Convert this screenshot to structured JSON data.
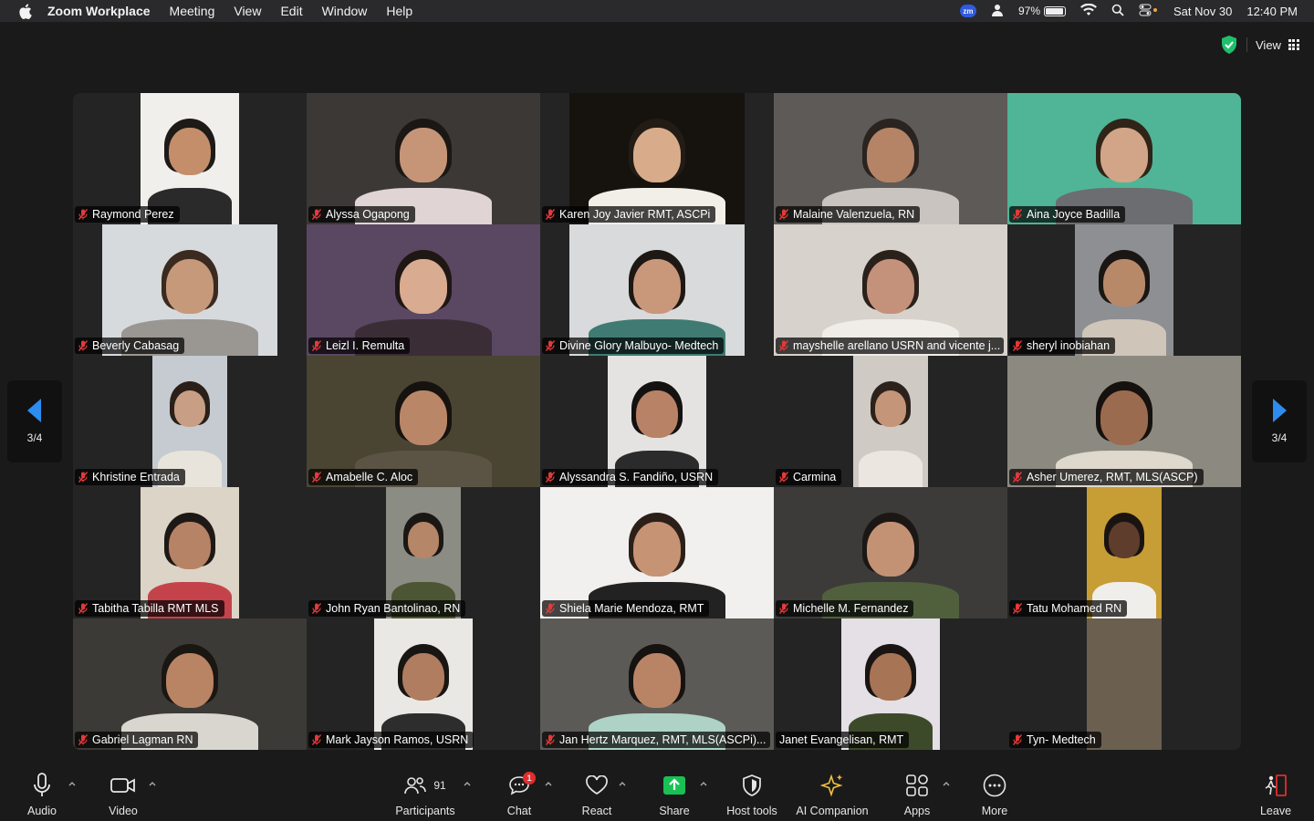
{
  "menubar": {
    "app_name": "Zoom Workplace",
    "items": [
      "Meeting",
      "View",
      "Edit",
      "Window",
      "Help"
    ],
    "battery": "97%",
    "date": "Sat Nov 30",
    "time": "12:40 PM",
    "zoom_badge": "zm"
  },
  "topbar": {
    "view_label": "View"
  },
  "pager": {
    "left_count": "3/4",
    "right_count": "3/4"
  },
  "participants": [
    {
      "name": "Raymond Perez",
      "bg": "#f0efec",
      "skin": "#c58e6b",
      "hair": "#1d1a18",
      "shirt": "#2a2a2a"
    },
    {
      "name": "Alyssa Ogapong",
      "bg": "#3b3836",
      "skin": "#c69578",
      "hair": "#1b1714",
      "shirt": "#e0d4d4"
    },
    {
      "name": "Karen Joy Javier RMT, ASCPi",
      "bg": "#16130f",
      "skin": "#d8ac8a",
      "hair": "#231c16",
      "shirt": "#f2efe9"
    },
    {
      "name": "Malaine Valenzuela, RN",
      "bg": "#5d5a57",
      "skin": "#b58466",
      "hair": "#2a2320",
      "shirt": "#c9c4c0"
    },
    {
      "name": "Aina Joyce Badilla",
      "bg": "#4fb596",
      "skin": "#d2a588",
      "hair": "#302418",
      "shirt": "#6c6d70"
    },
    {
      "name": "Beverly Cabasag",
      "bg": "#d7dadd",
      "skin": "#c6997b",
      "hair": "#3a2a1f",
      "shirt": "#9a9692"
    },
    {
      "name": "Leizl I. Remulta",
      "bg": "#5a4762",
      "skin": "#d9ab90",
      "hair": "#1f1714",
      "shirt": "#3b2d36"
    },
    {
      "name": "Divine Glory Malbuyo- Medtech",
      "bg": "#d9dadb",
      "skin": "#c9977a",
      "hair": "#1e1814",
      "shirt": "#3f7b73"
    },
    {
      "name": "mayshelle arellano USRN and vicente j...",
      "bg": "#d8d2cc",
      "skin": "#c4917a",
      "hair": "#2b211b",
      "shirt": "#f0ede8"
    },
    {
      "name": "sheryl inobiahan",
      "bg": "#8e8f93",
      "skin": "#b88969",
      "hair": "#1a1614",
      "shirt": "#cfc5b8"
    },
    {
      "name": "Khristine Entrada",
      "bg": "#c5cbd0",
      "skin": "#c89e84",
      "hair": "#2a2019",
      "shirt": "#e8e4dc"
    },
    {
      "name": "Amabelle C. Aloc",
      "bg": "#4a4433",
      "skin": "#b98768",
      "hair": "#161210",
      "shirt": "#5b5445"
    },
    {
      "name": "Alyssandra S. Fandiño, USRN",
      "bg": "#e4e3e1",
      "skin": "#b88266",
      "hair": "#141210",
      "shirt": "#2c2b2b"
    },
    {
      "name": "Carmina",
      "bg": "#cfcac4",
      "skin": "#c59579",
      "hair": "#2c221b",
      "shirt": "#ebe7e0"
    },
    {
      "name": "Asher Umerez, RMT, MLS(ASCP)",
      "bg": "#8c8a80",
      "skin": "#9b6b50",
      "hair": "#15110e",
      "shirt": "#ded8cd"
    },
    {
      "name": "Tabitha Tabilla RMT MLS",
      "bg": "#dcd4c6",
      "skin": "#b78366",
      "hair": "#1e1916",
      "shirt": "#c4434b"
    },
    {
      "name": "John Ryan Bantolinao, RN",
      "bg": "#8b8c84",
      "skin": "#b58667",
      "hair": "#1b1714",
      "shirt": "#4d5634"
    },
    {
      "name": "Shiela Marie Mendoza, RMT",
      "bg": "#f1f0ee",
      "skin": "#c69375",
      "hair": "#2b1f18",
      "shirt": "#222222"
    },
    {
      "name": "Michelle M. Fernandez",
      "bg": "#3c3b3a",
      "skin": "#c39275",
      "hair": "#1b1714",
      "shirt": "#50603d"
    },
    {
      "name": "Tatu Mohamed RN",
      "bg": "#c79d36",
      "skin": "#5f3d2c",
      "hair": "#1a1411",
      "shirt": "#f0eeea"
    },
    {
      "name": "Gabriel Lagman RN",
      "bg": "#3b3a37",
      "skin": "#b98464",
      "hair": "#1a1612",
      "shirt": "#d9d6cf"
    },
    {
      "name": "Mark Jayson Ramos, USRN",
      "bg": "#e9e8e5",
      "skin": "#b07d60",
      "hair": "#191513",
      "shirt": "#2d2d2d"
    },
    {
      "name": "Jan Hertz Marquez, RMT, MLS(ASCPi)...",
      "bg": "#5c5a57",
      "skin": "#b98466",
      "hair": "#151210",
      "shirt": "#aed3c6"
    },
    {
      "name": "Janet Evangelisan, RMT",
      "bg": "#e4e0e6",
      "skin": "#a87456",
      "hair": "#1a1512",
      "shirt": "#3d4a2a"
    },
    {
      "name": "Tyn- Medtech",
      "bg": "#6b5f50",
      "skin": "#6b5f50",
      "hair": "#6b5f50",
      "shirt": "#6b5f50"
    }
  ],
  "toolbar": {
    "audio": "Audio",
    "video": "Video",
    "participants": "Participants",
    "participants_count": "91",
    "chat": "Chat",
    "chat_badge": "1",
    "react": "React",
    "share": "Share",
    "host_tools": "Host tools",
    "ai_companion": "AI Companion",
    "apps": "Apps",
    "more": "More",
    "leave": "Leave"
  },
  "colors": {
    "share_green": "#19c154",
    "mute_red": "#e23a3a",
    "pager_blue": "#2d8cf0",
    "shield_green": "#1fc06c",
    "ai_gold": "#f3c13a"
  }
}
